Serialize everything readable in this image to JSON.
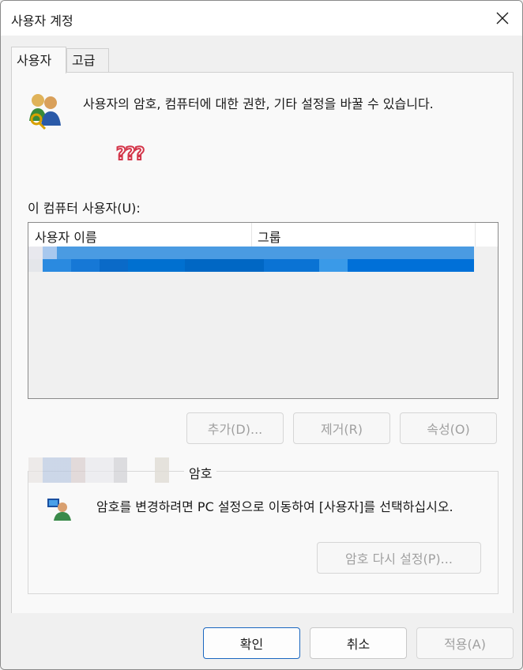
{
  "window": {
    "title": "사용자 계정",
    "close_icon": "close-icon"
  },
  "tabs": [
    {
      "label": "사용자"
    },
    {
      "label": "고급"
    }
  ],
  "intro": {
    "text": "사용자의 암호, 컴퓨터에 대한 권한, 기타 설정을 바꿀 수 있습니다.",
    "icon": "users-key-icon",
    "annotation": "???"
  },
  "users_list": {
    "label": "이 컴퓨터 사용자(U):",
    "columns": [
      "사용자 이름",
      "그룹"
    ],
    "rows": [
      {
        "name": "",
        "group": ""
      }
    ]
  },
  "list_buttons": {
    "add": "추가(D)...",
    "remove": "제거(R)",
    "properties": "속성(O)"
  },
  "password": {
    "group_label": "암호",
    "icon": "user-monitor-icon",
    "message": "암호를 변경하려면 PC 설정으로 이동하여 [사용자]를 선택하십시오.",
    "reset_button": "암호 다시 설정(P)..."
  },
  "footer": {
    "ok": "확인",
    "cancel": "취소",
    "apply": "적용(A)"
  },
  "colors": {
    "accent": "#1a67c0",
    "selection": "#0078d4",
    "annotation": "#d3364a"
  }
}
